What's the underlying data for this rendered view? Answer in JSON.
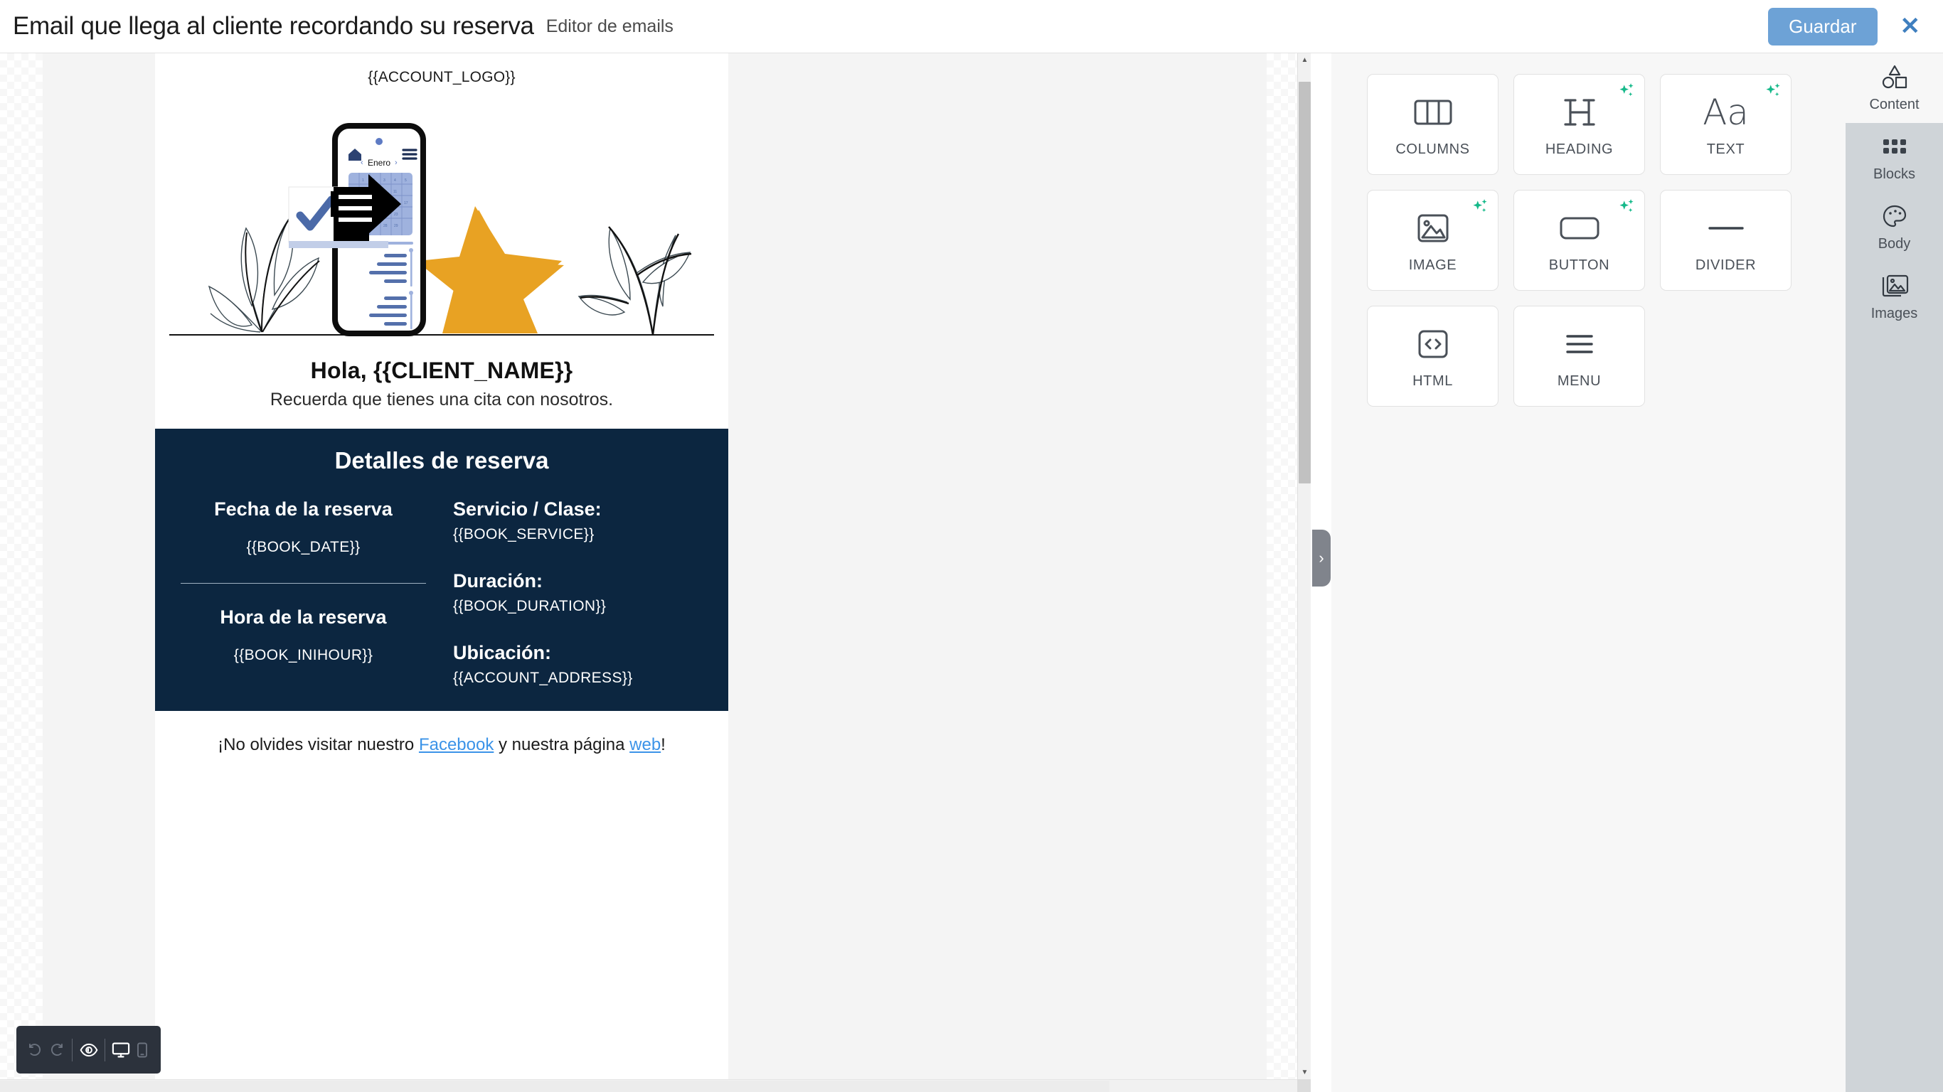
{
  "topbar": {
    "title": "Email que llega al cliente recordando su reserva",
    "subtitle": "Editor de emails",
    "save_label": "Guardar",
    "close_label": "✕",
    "accent_color": "#6da2d6"
  },
  "email": {
    "logo_placeholder": "{{ACCOUNT_LOGO}}",
    "illustration": {
      "phone_month_label": "Enero",
      "prev_arrow": "‹",
      "next_arrow": "›",
      "calendar_days": [
        "1",
        "2",
        "3",
        "4",
        "5",
        "9",
        "10",
        "11",
        "15",
        "16",
        "17",
        "21",
        "22",
        "23",
        "26",
        "27",
        "28",
        "29"
      ],
      "star_color": "#e8a223",
      "accent_blue": "#4b6aa8"
    },
    "greeting_title": "Hola, {{CLIENT_NAME}}",
    "greeting_subtitle": "Recuerda que tienes una cita con nosotros.",
    "details": {
      "panel_color": "#0c2640",
      "title": "Detalles de reserva",
      "left": [
        {
          "head": "Fecha de la reserva",
          "value": "{{BOOK_DATE}}"
        },
        {
          "head": "Hora de la reserva",
          "value": "{{BOOK_INIHOUR}}"
        }
      ],
      "right": [
        {
          "head": "Servicio / Clase:",
          "value": "{{BOOK_SERVICE}}"
        },
        {
          "head": "Duración:",
          "value": "{{BOOK_DURATION}}"
        },
        {
          "head": "Ubicación:",
          "value": "{{ACCOUNT_ADDRESS}}"
        }
      ]
    },
    "footer": {
      "prefix": "¡No olvides visitar nuestro ",
      "link1": "Facebook",
      "middle": " y nuestra página ",
      "link2": "web",
      "suffix": "!",
      "link_color": "#3b93e8"
    }
  },
  "bottom_toolbar": {
    "items": [
      {
        "name": "undo-icon",
        "enabled": false
      },
      {
        "name": "redo-icon",
        "enabled": false
      },
      {
        "name": "preview-eye-icon",
        "enabled": true
      },
      {
        "name": "desktop-view-icon",
        "enabled": true
      },
      {
        "name": "mobile-view-icon",
        "enabled": false
      }
    ]
  },
  "collapse_handle": {
    "glyph": "›"
  },
  "content_panel": {
    "tiles": [
      {
        "label": "COLUMNS",
        "icon": "columns-icon",
        "ai": false
      },
      {
        "label": "HEADING",
        "icon": "heading-icon",
        "ai": true
      },
      {
        "label": "TEXT",
        "icon": "text-icon",
        "ai": true
      },
      {
        "label": "IMAGE",
        "icon": "image-icon",
        "ai": true
      },
      {
        "label": "BUTTON",
        "icon": "button-icon",
        "ai": true
      },
      {
        "label": "DIVIDER",
        "icon": "divider-icon",
        "ai": false
      },
      {
        "label": "HTML",
        "icon": "html-icon",
        "ai": false
      },
      {
        "label": "MENU",
        "icon": "menu-icon",
        "ai": false
      }
    ],
    "ai_badge_color": "#16b98a"
  },
  "nav_rail": {
    "items": [
      {
        "label": "Content",
        "icon": "shapes-icon",
        "active": true
      },
      {
        "label": "Blocks",
        "icon": "blocks-icon",
        "active": false
      },
      {
        "label": "Body",
        "icon": "palette-icon",
        "active": false
      },
      {
        "label": "Images",
        "icon": "images-icon",
        "active": false
      }
    ]
  }
}
